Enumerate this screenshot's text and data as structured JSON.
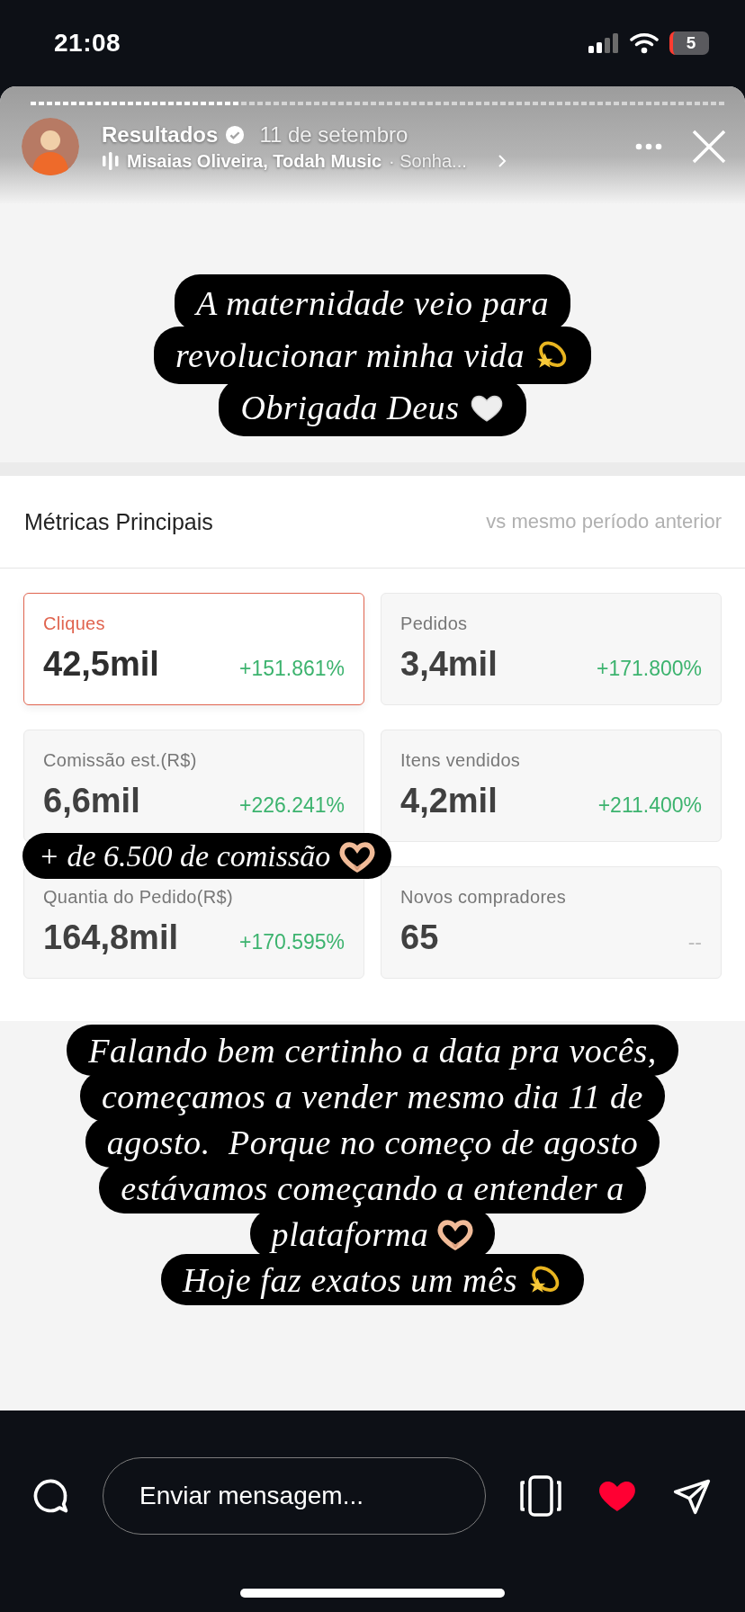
{
  "status_bar": {
    "time": "21:08",
    "battery": "5"
  },
  "story": {
    "progress": {
      "level": 0.3
    },
    "account": "Resultados",
    "verified": true,
    "date": "11 de setembro",
    "music": {
      "artist": "Misaias Oliveira, Todah Music",
      "title": "· Sonha..."
    }
  },
  "caption_top": [
    {
      "text": "A maternidade veio para"
    },
    {
      "text": "revolucionar minha vida",
      "kind": "dizzy"
    },
    {
      "text": "Obrigada Deus",
      "kind": "heart"
    }
  ],
  "metrics": {
    "title": "Métricas Principais",
    "comparison": "vs mesmo período anterior",
    "cards": [
      {
        "label": "Cliques",
        "value": "42,5mil",
        "change": "+151.861%",
        "kind": "growth",
        "selected": true
      },
      {
        "label": "Pedidos",
        "value": "3,4mil",
        "change": "+171.800%",
        "kind": "growth",
        "selected": false
      },
      {
        "label": "Comissão est.(R$)",
        "value": "6,6mil",
        "change": "+226.241%",
        "kind": "growth",
        "selected": false
      },
      {
        "label": "Itens vendidos",
        "value": "4,2mil",
        "change": "+211.400%",
        "kind": "growth",
        "selected": false
      },
      {
        "label": "Quantia do Pedido(R$)",
        "value": "164,8mil",
        "change": "+170.595%",
        "kind": "growth",
        "selected": false
      },
      {
        "label": "Novos compradores",
        "value": "65",
        "change": "--",
        "kind": "empty",
        "selected": false
      }
    ]
  },
  "overlay_caption": {
    "text": "+ de 6.500 de comissão",
    "kind": "hands"
  },
  "caption_bottom": [
    {
      "text": "Falando bem certinho a data pra vocês,"
    },
    {
      "text": "começamos a vender mesmo dia 11 de"
    },
    {
      "text": "agosto.  Porque no começo de agosto"
    },
    {
      "text": "estávamos começando a entender a"
    },
    {
      "text": "plataforma",
      "kind": "hands"
    },
    {
      "text": "Hoje faz exatos um mês",
      "kind": "dizzy"
    }
  ],
  "reply_bar": {
    "placeholder": "Enviar mensagem...",
    "liked": true
  }
}
